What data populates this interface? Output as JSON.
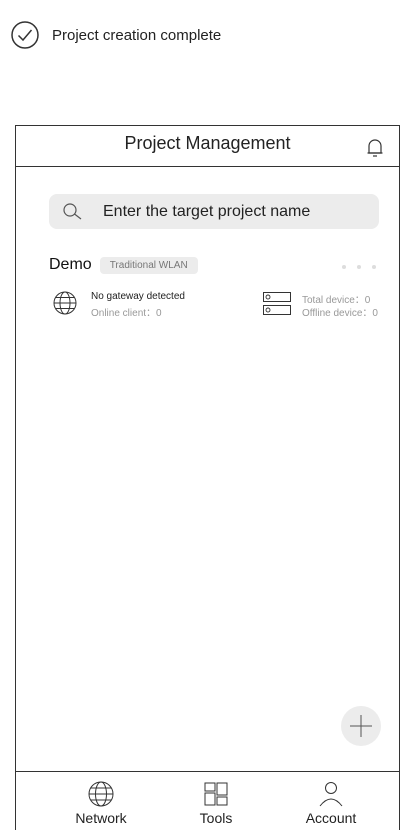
{
  "caption": {
    "text": "Project creation complete",
    "icon": "check-circle-icon"
  },
  "header": {
    "title": "Project Management",
    "icon": "bell-icon"
  },
  "search": {
    "placeholder": "Enter the target project name",
    "icon": "search-icon"
  },
  "project": {
    "name": "Demo",
    "tag": "Traditional WLAN",
    "gateway_status": "No gateway detected",
    "online_client": "Online client：0",
    "total_device": "Total device：0",
    "offline_device": "Offline device：0"
  },
  "fab": {
    "icon": "plus-icon"
  },
  "tabs": [
    {
      "label": "Network",
      "icon": "globe-icon"
    },
    {
      "label": "Tools",
      "icon": "grid-icon"
    },
    {
      "label": "Account",
      "icon": "user-icon"
    }
  ],
  "colors": {
    "stroke": "#333333",
    "pill": "#ececec",
    "muted": "#999999"
  }
}
